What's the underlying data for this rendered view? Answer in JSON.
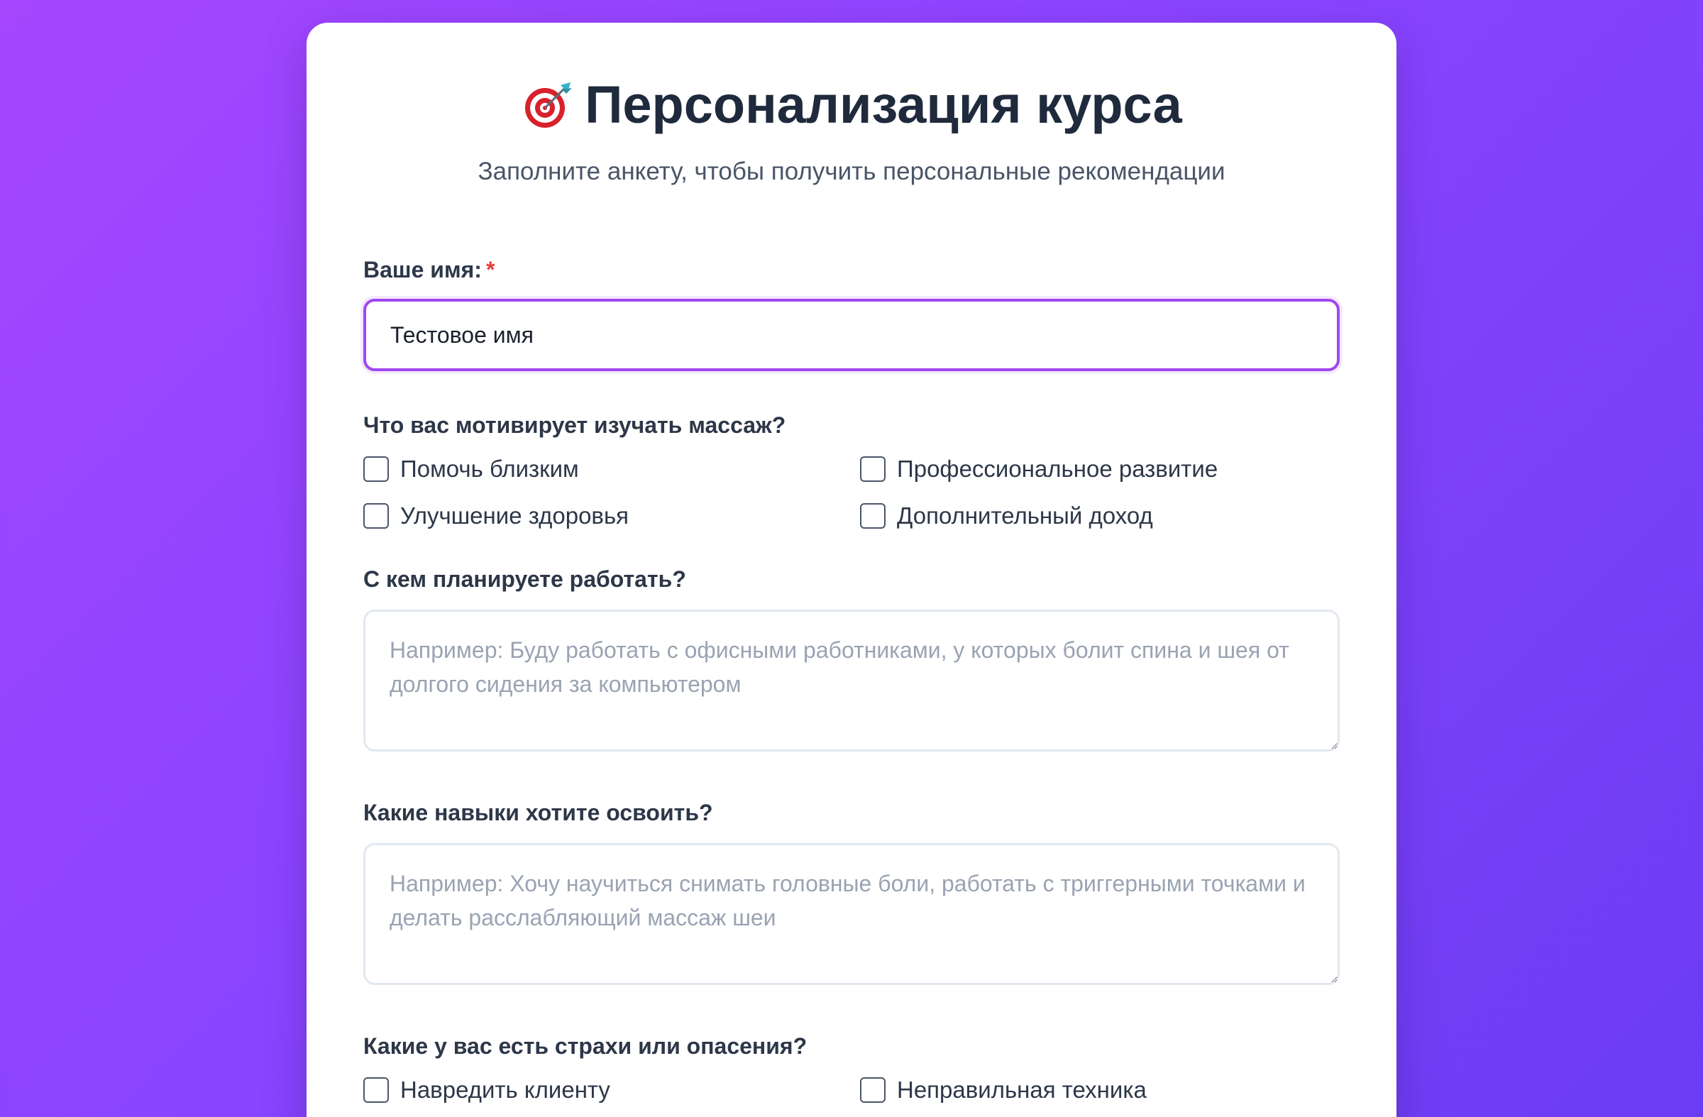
{
  "header": {
    "icon": "target-icon",
    "title": "Персонализация курса",
    "subtitle": "Заполните анкету, чтобы получить персональные рекомендации"
  },
  "form": {
    "name": {
      "label": "Ваше имя:",
      "required_mark": "*",
      "value": "Тестовое имя"
    },
    "motivation": {
      "label": "Что вас мотивирует изучать массаж?",
      "options": [
        "Помочь близким",
        "Профессиональное развитие",
        "Улучшение здоровья",
        "Дополнительный доход"
      ]
    },
    "audience": {
      "label": "С кем планируете работать?",
      "placeholder": "Например: Буду работать с офисными работниками, у которых болит спина и шея от долгого сидения за компьютером"
    },
    "skills": {
      "label": "Какие навыки хотите освоить?",
      "placeholder": "Например: Хочу научиться снимать головные боли, работать с триггерными точками и делать расслабляющий массаж шеи"
    },
    "fears": {
      "label": "Какие у вас есть страхи или опасения?",
      "options": [
        "Навредить клиенту",
        "Неправильная техника"
      ]
    }
  },
  "colors": {
    "accent": "#a046f0",
    "required": "#e53e3e",
    "background_start": "#a646ff",
    "background_end": "#6a3cf3"
  }
}
